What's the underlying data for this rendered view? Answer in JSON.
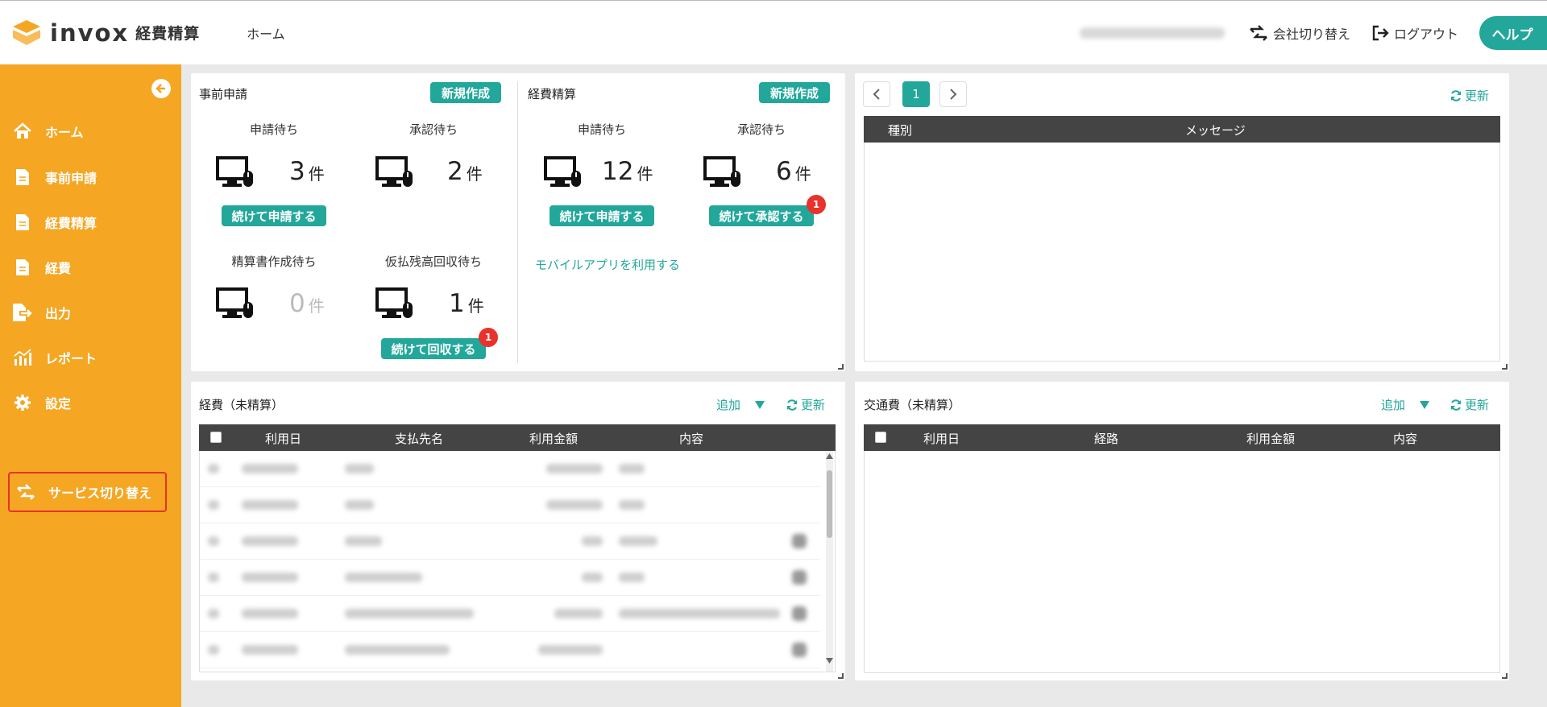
{
  "header": {
    "brand": "invox",
    "brand_sub": "経費精算",
    "nav_home": "ホーム",
    "switch_company": "会社切り替え",
    "logout": "ログアウト",
    "help": "ヘルプ"
  },
  "sidebar": {
    "items": [
      {
        "label": "ホーム",
        "icon": "home-icon"
      },
      {
        "label": "事前申請",
        "icon": "document-icon"
      },
      {
        "label": "経費精算",
        "icon": "document-icon"
      },
      {
        "label": "経費",
        "icon": "document-icon"
      },
      {
        "label": "出力",
        "icon": "export-icon"
      },
      {
        "label": "レポート",
        "icon": "report-icon"
      },
      {
        "label": "設定",
        "icon": "gear-icon"
      }
    ],
    "service_switch": "サービス切り替え"
  },
  "pre_application": {
    "title": "事前申請",
    "new_button": "新規作成",
    "stats": [
      {
        "label": "申請待ち",
        "count": "3",
        "unit": "件",
        "action": "続けて申請する"
      },
      {
        "label": "承認待ち",
        "count": "2",
        "unit": "件"
      },
      {
        "label": "精算書作成待ち",
        "count": "0",
        "unit": "件"
      },
      {
        "label": "仮払残高回収待ち",
        "count": "1",
        "unit": "件",
        "action": "続けて回収する",
        "badge": "1"
      }
    ]
  },
  "expense_settlement": {
    "title": "経費精算",
    "new_button": "新規作成",
    "stats": [
      {
        "label": "申請待ち",
        "count": "12",
        "unit": "件",
        "action": "続けて申請する"
      },
      {
        "label": "承認待ち",
        "count": "6",
        "unit": "件",
        "action": "続けて承認する",
        "badge": "1"
      }
    ],
    "mobile_link": "モバイルアプリを利用する"
  },
  "messages": {
    "page": "1",
    "refresh": "更新",
    "columns": [
      "種別",
      "メッセージ"
    ]
  },
  "expenses": {
    "title": "経費（未精算）",
    "add": "追加",
    "refresh": "更新",
    "columns": [
      "利用日",
      "支払先名",
      "利用金額",
      "内容"
    ]
  },
  "transport": {
    "title": "交通費（未精算）",
    "add": "追加",
    "refresh": "更新",
    "columns": [
      "利用日",
      "経路",
      "利用金額",
      "内容"
    ]
  },
  "colors": {
    "accent": "#22a79a",
    "sidebar": "#f5a623",
    "badge": "#e8322b"
  }
}
